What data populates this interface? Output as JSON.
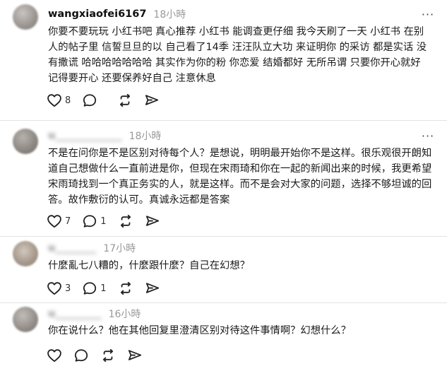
{
  "comments": [
    {
      "username": "wangxiaofei6167",
      "time": "18小時",
      "text": "你要不要玩玩 小红书吧 真心推荐 小红书 能调查更仔细 我今天刷了一天 小红书 在别人的帖子里 信誓旦旦的以 自己看了14季 汪汪队立大功 来证明你 的采访 都是实话 没有撒谎 哈哈哈哈哈哈哈 其实作为你的粉 你恋爱 结婚都好 无所吊谓 只要你开心就好 记得要开心 还要保养好自己 注意休息",
      "likes": "8",
      "replies": ""
    },
    {
      "username": "u_____________",
      "time": "18小時",
      "text": "不是在问你是不是区别对待每个人？是想说，明明最开始你不是这样。很乐观很开朗知道自己想做什么一直前进是你，但现在宋雨琦和你在一起的新闻出来的时候，我更希望宋雨琦找到一个真正务实的人，就是这样。而不是会对大家的问题，选择不够坦诚的回答。故作敷衍的认可。真诚永远都是答案",
      "likes": "7",
      "replies": "1"
    },
    {
      "username": "u________",
      "time": "17小時",
      "text": "什麼亂七八糟的，什麼跟什麼？自己在幻想？",
      "likes": "3",
      "replies": "1"
    },
    {
      "username": "u_________",
      "time": "16小時",
      "text": "你在说什么？他在其他回复里澄清区别对待这件事情啊？幻想什么？",
      "likes": "",
      "replies": ""
    }
  ],
  "icons": {
    "like": "heart-icon",
    "reply": "comment-icon",
    "repost": "repost-icon",
    "share": "share-icon",
    "more": "more-icon"
  },
  "colors": {
    "text": "#1a1a1a",
    "muted": "#999999",
    "divider": "#e3e3e3"
  },
  "ui": {
    "more_glyph": "···"
  }
}
